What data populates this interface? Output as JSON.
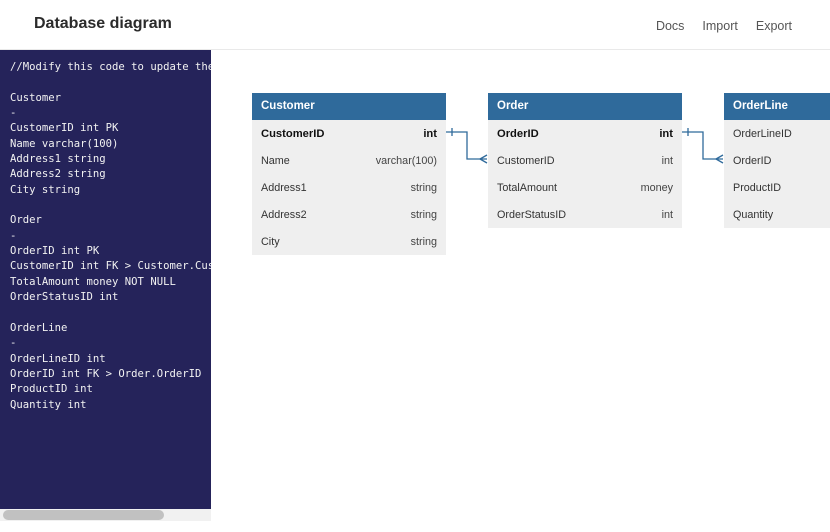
{
  "header": {
    "title": "Database diagram",
    "nav": [
      "Docs",
      "Import",
      "Export"
    ]
  },
  "editor": {
    "lines": [
      "//Modify this code to update the DB schema diagram.",
      "",
      "Customer",
      "-",
      "CustomerID int PK",
      "Name varchar(100)",
      "Address1 string",
      "Address2 string",
      "City string",
      "",
      "Order",
      "-",
      "OrderID int PK",
      "CustomerID int FK > Customer.CustomerID",
      "TotalAmount money NOT NULL",
      "OrderStatusID int",
      "",
      "OrderLine",
      "-",
      "OrderLineID int",
      "OrderID int FK > Order.OrderID",
      "ProductID int",
      "Quantity int"
    ]
  },
  "colors": {
    "editor_bg": "#25235a",
    "table_header": "#2f6a9b",
    "table_body": "#efefef",
    "connector": "#2f6a9b"
  },
  "tables": [
    {
      "name": "Customer",
      "rows": [
        {
          "name": "CustomerID",
          "type": "int",
          "pk": true
        },
        {
          "name": "Name",
          "type": "varchar(100)",
          "pk": false
        },
        {
          "name": "Address1",
          "type": "string",
          "pk": false
        },
        {
          "name": "Address2",
          "type": "string",
          "pk": false
        },
        {
          "name": "City",
          "type": "string",
          "pk": false
        }
      ]
    },
    {
      "name": "Order",
      "rows": [
        {
          "name": "OrderID",
          "type": "int",
          "pk": true
        },
        {
          "name": "CustomerID",
          "type": "int",
          "pk": false
        },
        {
          "name": "TotalAmount",
          "type": "money",
          "pk": false
        },
        {
          "name": "OrderStatusID",
          "type": "int",
          "pk": false
        }
      ]
    },
    {
      "name": "OrderLine",
      "rows": [
        {
          "name": "OrderLineID",
          "type": "",
          "pk": false
        },
        {
          "name": "OrderID",
          "type": "",
          "pk": false
        },
        {
          "name": "ProductID",
          "type": "",
          "pk": false
        },
        {
          "name": "Quantity",
          "type": "",
          "pk": false
        }
      ]
    }
  ]
}
